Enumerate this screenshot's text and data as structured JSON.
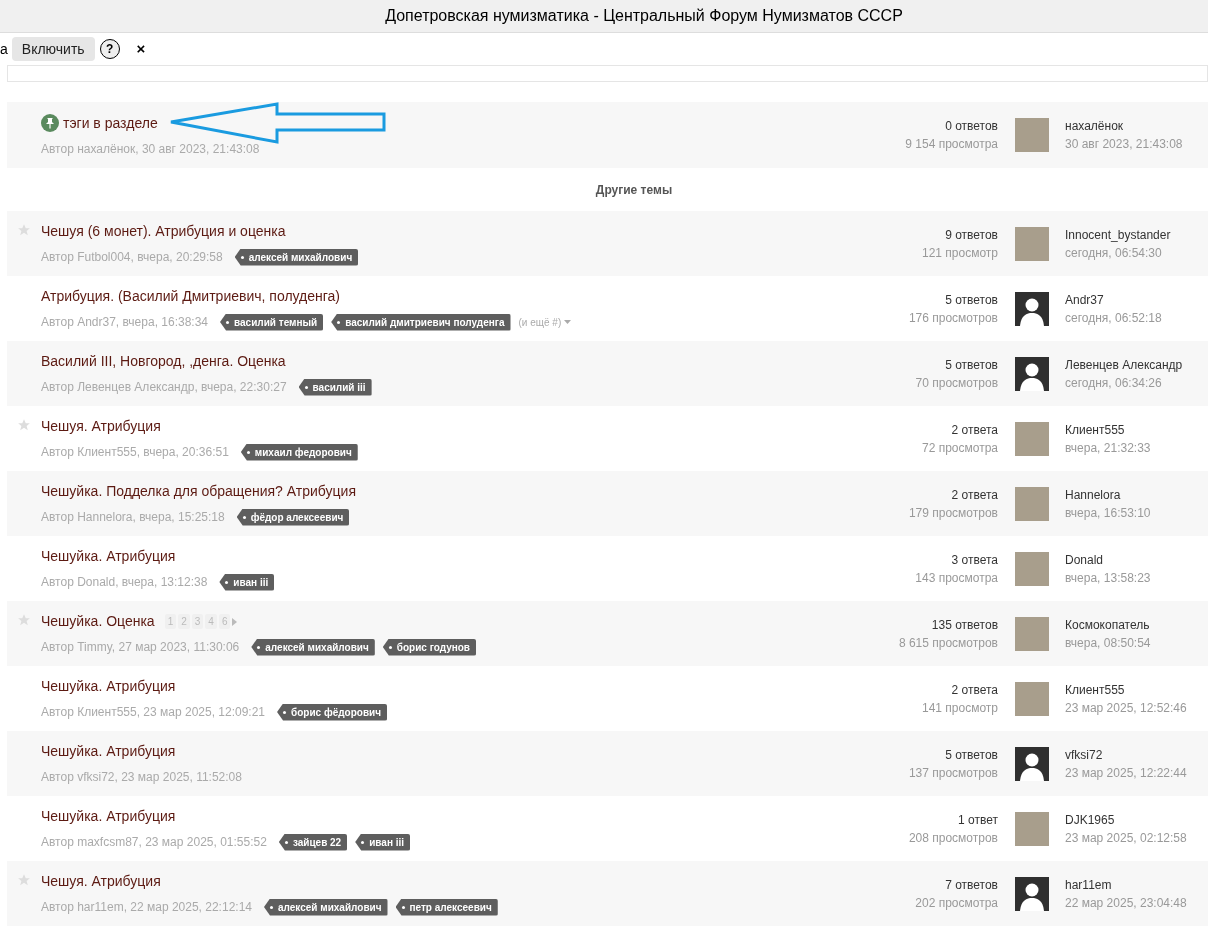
{
  "window": {
    "title": "Допетровская нумизматика - Центральный Форум Нумизматов СССР"
  },
  "toolbar": {
    "cut_text": "а",
    "enable_button": "Включить",
    "help": "?",
    "close": "×"
  },
  "pinned_topic": {
    "title": "тэги в разделе",
    "author_line": "Автор нахалёнок, 30 авг 2023, 21:43:08",
    "replies": "0 ответов",
    "views": "9 154 просмотра",
    "avatar": {
      "kind": "photo"
    },
    "last_user": "нахалёнок",
    "last_time": "30 авг 2023, 21:43:08"
  },
  "section_heading": "Другие темы",
  "topics": [
    {
      "title": "Чешуя (6 монет). Атрибуция и оценка",
      "starred": true,
      "author_line": "Автор Futbol004, вчера, 20:29:58",
      "tags": [
        "алексей михайлович"
      ],
      "replies": "9 ответов",
      "views": "121 просмотр",
      "avatar": {
        "kind": "photo"
      },
      "last_user": "Innocent_bystander",
      "last_time": "сегодня, 06:54:30"
    },
    {
      "title": "Атрибуция. (Василий Дмитриевич, полуденга)",
      "starred": false,
      "author_line": "Автор Andr37, вчера, 16:38:34",
      "tags": [
        "василий темный",
        "василий дмитриевич полуденга"
      ],
      "more": "(и ещё #)",
      "replies": "5 ответов",
      "views": "176 просмотров",
      "avatar": {
        "kind": "silhouette"
      },
      "last_user": "Andr37",
      "last_time": "сегодня, 06:52:18"
    },
    {
      "title": "Василий III, Новгород, ,денга. Оценка",
      "starred": false,
      "author_line": "Автор Левенцев Александр, вчера, 22:30:27",
      "tags": [
        "василий iii"
      ],
      "replies": "5 ответов",
      "views": "70 просмотров",
      "avatar": {
        "kind": "silhouette"
      },
      "last_user": "Левенцев Александр",
      "last_time": "сегодня, 06:34:26"
    },
    {
      "title": "Чешуя. Атрибуция",
      "starred": true,
      "author_line": "Автор Клиент555, вчера, 20:36:51",
      "tags": [
        "михаил федорович"
      ],
      "replies": "2 ответа",
      "views": "72 просмотра",
      "avatar": {
        "kind": "photo"
      },
      "last_user": "Клиент555",
      "last_time": "вчера, 21:32:33"
    },
    {
      "title": "Чешуйка. Подделка для обращения? Атрибуция",
      "starred": false,
      "author_line": "Автор Hannelora, вчера, 15:25:18",
      "tags": [
        "фёдор алексеевич"
      ],
      "replies": "2 ответа",
      "views": "179 просмотров",
      "avatar": {
        "kind": "photo"
      },
      "last_user": "Hannelora",
      "last_time": "вчера, 16:53:10"
    },
    {
      "title": "Чешуйка. Атрибуция",
      "starred": false,
      "author_line": "Автор Donald, вчера, 13:12:38",
      "tags": [
        "иван iii"
      ],
      "replies": "3 ответа",
      "views": "143 просмотра",
      "avatar": {
        "kind": "photo"
      },
      "last_user": "Donald",
      "last_time": "вчера, 13:58:23"
    },
    {
      "title": "Чешуйка. Оценка",
      "starred": true,
      "pages": [
        "1",
        "2",
        "3",
        "4",
        "6"
      ],
      "author_line": "Автор Timmy, 27 мар 2023, 11:30:06",
      "tags": [
        "алексей михайлович",
        "борис годунов"
      ],
      "replies": "135 ответов",
      "views": "8 615 просмотров",
      "avatar": {
        "kind": "photo"
      },
      "last_user": "Космокопатель",
      "last_time": "вчера, 08:50:54"
    },
    {
      "title": "Чешуйка. Атрибуция",
      "starred": false,
      "author_line": "Автор Клиент555, 23 мар 2025, 12:09:21",
      "tags": [
        "борис фёдорович"
      ],
      "replies": "2 ответа",
      "views": "141 просмотр",
      "avatar": {
        "kind": "photo"
      },
      "last_user": "Клиент555",
      "last_time": "23 мар 2025, 12:52:46"
    },
    {
      "title": "Чешуйка. Атрибуция",
      "starred": false,
      "author_line": "Автор vfksi72, 23 мар 2025, 11:52:08",
      "replies": "5 ответов",
      "views": "137 просмотров",
      "avatar": {
        "kind": "silhouette"
      },
      "last_user": "vfksi72",
      "last_time": "23 мар 2025, 12:22:44"
    },
    {
      "title": "Чешуйка. Атрибуция",
      "starred": false,
      "author_line": "Автор maxfcsm87, 23 мар 2025, 01:55:52",
      "tags": [
        "зайцев 22",
        "иван iii"
      ],
      "replies": "1 ответ",
      "views": "208 просмотров",
      "avatar": {
        "kind": "photo"
      },
      "last_user": "DJK1965",
      "last_time": "23 мар 2025, 02:12:58"
    },
    {
      "title": "Чешуя. Атрибуция",
      "starred": true,
      "author_line": "Автор har11em, 22 мар 2025, 22:12:14",
      "tags": [
        "алексей михайлович",
        "петр алексеевич"
      ],
      "replies": "7 ответов",
      "views": "202 просмотра",
      "avatar": {
        "kind": "silhouette"
      },
      "last_user": "har11em",
      "last_time": "22 мар 2025, 23:04:48"
    }
  ]
}
